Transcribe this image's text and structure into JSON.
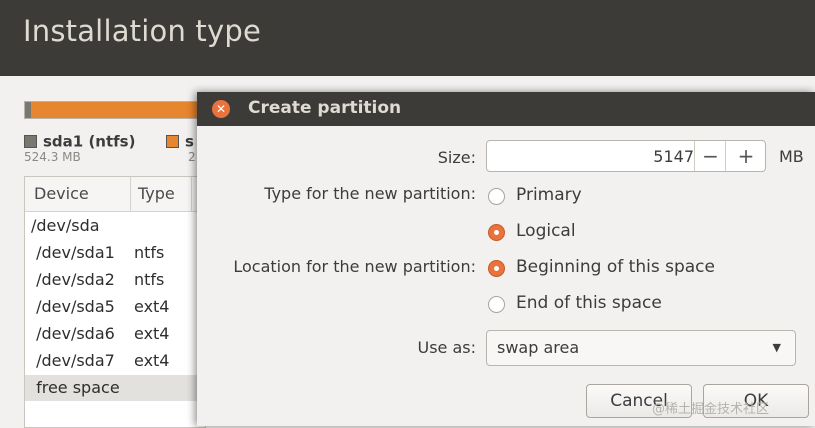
{
  "window": {
    "title": "Installation type"
  },
  "disk": {
    "legend": [
      {
        "name": "sda1 (ntfs)",
        "size": "524.3 MB",
        "color": "#7a7670"
      },
      {
        "name": "s",
        "size": "2",
        "color": "#e8852f"
      }
    ],
    "table": {
      "headers": [
        "Device",
        "Type"
      ],
      "rows": [
        {
          "device": "/dev/sda",
          "type": ""
        },
        {
          "device": " /dev/sda1",
          "type": "ntfs"
        },
        {
          "device": " /dev/sda2",
          "type": "ntfs"
        },
        {
          "device": " /dev/sda5",
          "type": "ext4"
        },
        {
          "device": " /dev/sda6",
          "type": "ext4"
        },
        {
          "device": " /dev/sda7",
          "type": "ext4"
        },
        {
          "device": " free space",
          "type": ""
        }
      ]
    }
  },
  "dialog": {
    "title": "Create partition",
    "size": {
      "label": "Size:",
      "value": "5147",
      "minus": "−",
      "plus": "+",
      "unit": "MB"
    },
    "type": {
      "label": "Type for the new partition:",
      "options": [
        {
          "label": "Primary",
          "selected": false
        },
        {
          "label": "Logical",
          "selected": true
        }
      ]
    },
    "location": {
      "label": "Location for the new partition:",
      "options": [
        {
          "label": "Beginning of this space",
          "selected": true
        },
        {
          "label": "End of this space",
          "selected": false
        }
      ]
    },
    "use_as": {
      "label": "Use as:",
      "value": "swap area"
    },
    "buttons": {
      "cancel": "Cancel",
      "ok": "OK"
    }
  },
  "watermark": "@稀土掘金技术社区",
  "colors": {
    "accent": "#e9733d",
    "titlebar": "#3c3b37",
    "background": "#f2f1f0"
  },
  "icons": {
    "close": "close-icon",
    "dropdown": "chevron-down-icon"
  }
}
